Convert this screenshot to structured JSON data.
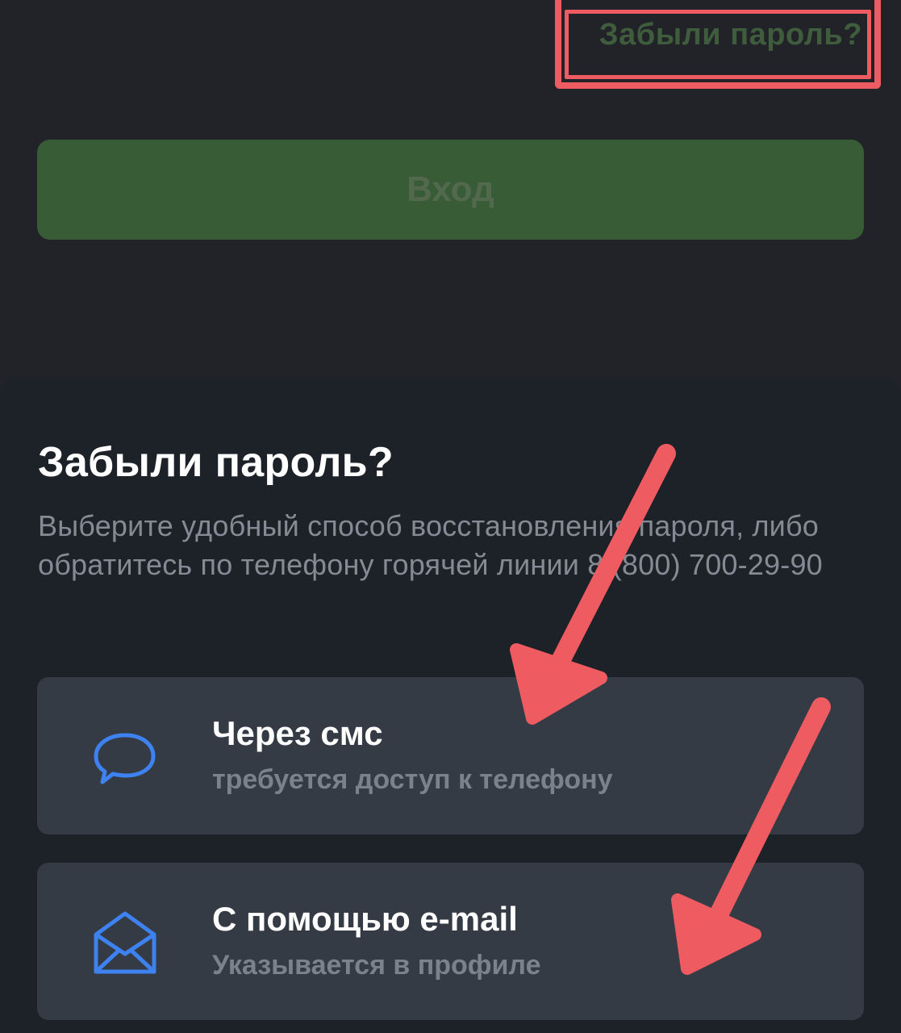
{
  "login": {
    "forgot_password_link": "Забыли пароль?",
    "login_button_label": "Вход"
  },
  "sheet": {
    "title": "Забыли пароль?",
    "description": "Выберите удобный способ восстановления пароля, либо обратитесь по телефону горячей линии 8 (800) 700-29-90",
    "options": [
      {
        "icon": "chat-bubble-icon",
        "title": "Через смс",
        "subtitle": "требуется доступ к телефону"
      },
      {
        "icon": "envelope-icon",
        "title": "С помощью e-mail",
        "subtitle": "Указывается в профиле"
      }
    ]
  },
  "colors": {
    "background": "#212328",
    "sheet_background": "#1d2128",
    "option_background": "#343b44",
    "login_button": "#385c35",
    "accent_icon": "#3d82f0",
    "annotation_red": "#ee5b60"
  }
}
